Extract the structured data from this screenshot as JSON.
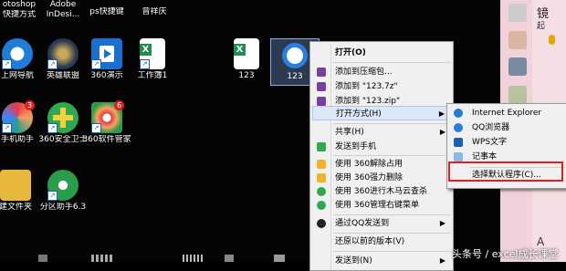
{
  "desktop_icons": [
    {
      "label": "otoshop",
      "label2": "快捷方式",
      "color": "#1e3c72"
    },
    {
      "label": "Adobe",
      "label2": "InDesi...",
      "color": "#b3005e"
    },
    {
      "label": "ps快捷键",
      "label2": "",
      "color": "#2b2b2b"
    },
    {
      "label": "曾祥庆",
      "label2": "",
      "color": "#2b2b2b"
    },
    {
      "label": "上网导航",
      "label2": "",
      "color": "#1f7dd6"
    },
    {
      "label": "英雄联盟",
      "label2": "",
      "color": "#3a3320"
    },
    {
      "label": "360演示",
      "label2": "",
      "color": "#1a6fd1"
    },
    {
      "label": "工作簿1",
      "label2": "",
      "color": "#1e8f4e"
    },
    {
      "label": "123",
      "label2": "",
      "color": "#1e8f4e"
    },
    {
      "label": "123",
      "label2": "",
      "color": "#2a7de1"
    },
    {
      "label": "手机助手",
      "label2": "",
      "color": "#e65c2c"
    },
    {
      "label": "360安全卫士",
      "label2": "",
      "color": "#2fa84f"
    },
    {
      "label": "360软件管家",
      "label2": "",
      "color": "#e63946"
    },
    {
      "label": "建文件夹",
      "label2": "",
      "color": "#e6b83c"
    },
    {
      "label": "分区助手6.3",
      "label2": "",
      "color": "#2a9d4a"
    }
  ],
  "menu": {
    "items": [
      {
        "label": "打开(O)",
        "bold": true,
        "icon": "none"
      },
      {
        "label": "添加到压缩包...",
        "icon": "winrar-icon"
      },
      {
        "label": "添加到 \"123.7z\"",
        "icon": "winrar-icon"
      },
      {
        "label": "添加到 \"123.zip\"",
        "icon": "winrar-icon"
      },
      {
        "label": "打开方式(H)",
        "icon": "none",
        "arrow": "▶"
      },
      {
        "label": "共享(H)",
        "icon": "none",
        "arrow": "▶"
      },
      {
        "label": "发送到手机",
        "icon": "phone-icon"
      },
      {
        "label": "使用 360解除占用",
        "icon": "360-unlock-icon"
      },
      {
        "label": "使用 360强力删除",
        "icon": "360-delete-icon"
      },
      {
        "label": "使用 360进行木马云查杀",
        "icon": "360-scan-icon"
      },
      {
        "label": "使用 360管理右键菜单",
        "icon": "360-menu-icon"
      },
      {
        "label": "通过QQ发送到",
        "icon": "qq-icon",
        "arrow": "▶"
      },
      {
        "label": "还原以前的版本(V)",
        "icon": "none"
      },
      {
        "label": "发送到(N)",
        "icon": "none",
        "arrow": "▶"
      }
    ]
  },
  "submenu": {
    "items": [
      {
        "label": "Internet Explorer",
        "icon": "ie-icon"
      },
      {
        "label": "QQ浏览器",
        "icon": "qq-browser-icon"
      },
      {
        "label": "WPS文字",
        "icon": "wps-icon"
      },
      {
        "label": "记事本",
        "icon": "notepad-icon"
      },
      {
        "label": "选择默认程序(C)...",
        "icon": "none"
      }
    ]
  },
  "right_panel": {
    "title": "镜",
    "line2": "起",
    "bottom": "A"
  },
  "watermark": "头条号 / excel成长课堂",
  "colors": {
    "highlight_border": "#e02020",
    "menu_bg": "#f0f0f0",
    "menu_hover": "#dce8f8"
  }
}
